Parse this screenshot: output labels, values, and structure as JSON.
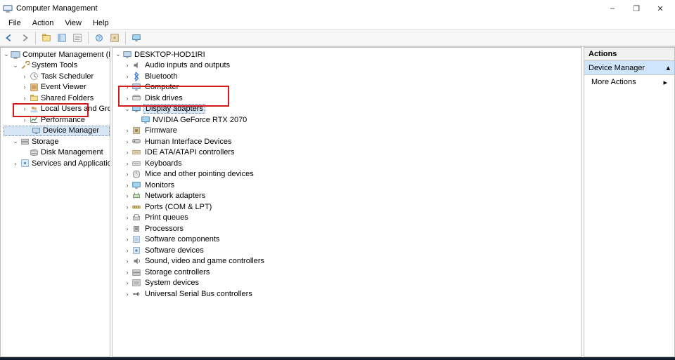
{
  "window": {
    "title": "Computer Management",
    "controls": {
      "minimize": "–",
      "maximize": "❐",
      "close": "✕"
    }
  },
  "menu": [
    "File",
    "Action",
    "View",
    "Help"
  ],
  "toolbar_icons": [
    "back",
    "forward",
    "up",
    "show-hide",
    "refresh",
    "properties",
    "help",
    "export",
    "monitor"
  ],
  "left_tree": {
    "root": "Computer Management (Local)",
    "system_tools": {
      "label": "System Tools",
      "children": [
        "Task Scheduler",
        "Event Viewer",
        "Shared Folders",
        "Local Users and Groups",
        "Performance",
        "Device Manager"
      ]
    },
    "storage": {
      "label": "Storage",
      "children": [
        "Disk Management"
      ]
    },
    "services": "Services and Applications"
  },
  "device_tree": {
    "root": "DESKTOP-HOD1IRI",
    "categories": [
      {
        "label": "Audio inputs and outputs",
        "exp": false
      },
      {
        "label": "Bluetooth",
        "exp": false
      },
      {
        "label": "Computer",
        "exp": false
      },
      {
        "label": "Disk drives",
        "exp": false
      },
      {
        "label": "Display adapters",
        "exp": true,
        "children": [
          "NVIDIA GeForce RTX 2070"
        ]
      },
      {
        "label": "Firmware",
        "exp": false
      },
      {
        "label": "Human Interface Devices",
        "exp": false
      },
      {
        "label": "IDE ATA/ATAPI controllers",
        "exp": false
      },
      {
        "label": "Keyboards",
        "exp": false
      },
      {
        "label": "Mice and other pointing devices",
        "exp": false
      },
      {
        "label": "Monitors",
        "exp": false
      },
      {
        "label": "Network adapters",
        "exp": false
      },
      {
        "label": "Ports (COM & LPT)",
        "exp": false
      },
      {
        "label": "Print queues",
        "exp": false
      },
      {
        "label": "Processors",
        "exp": false
      },
      {
        "label": "Software components",
        "exp": false
      },
      {
        "label": "Software devices",
        "exp": false
      },
      {
        "label": "Sound, video and game controllers",
        "exp": false
      },
      {
        "label": "Storage controllers",
        "exp": false
      },
      {
        "label": "System devices",
        "exp": false
      },
      {
        "label": "Universal Serial Bus controllers",
        "exp": false
      }
    ]
  },
  "actions": {
    "header": "Actions",
    "selected": "Device Manager",
    "items": [
      "More Actions"
    ]
  },
  "glyphs": {
    "collapsed": "›",
    "expanded": "⌄",
    "triangle_up": "▴",
    "triangle_right": "▸"
  }
}
